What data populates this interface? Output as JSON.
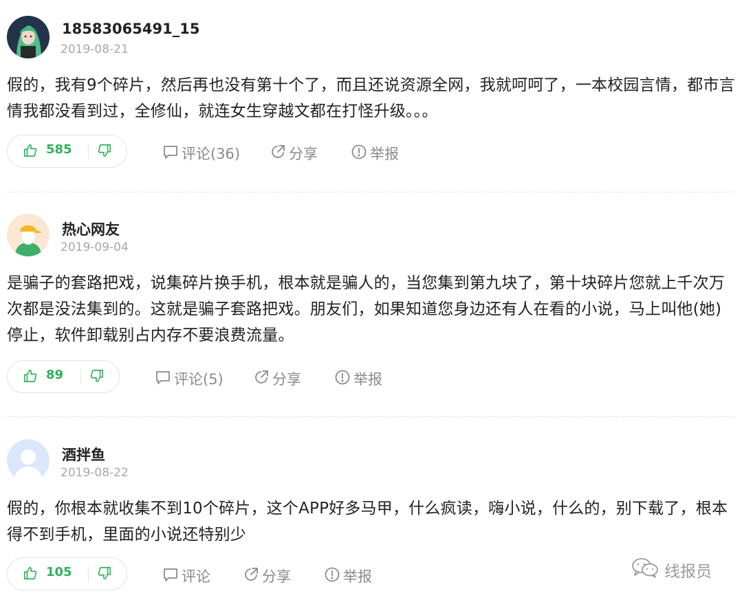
{
  "comments": [
    {
      "username": "18583065491_15",
      "date": "2019-08-21",
      "text": "假的，我有9个碎片，然后再也没有第十个了，而且还说资源全网，我就呵呵了，一本校园言情，都市言情我都没看到过，全修仙，就连女生穿越文都在打怪升级。。。",
      "likes": "585",
      "comment_label": "评论(36)",
      "share_label": "分享",
      "report_label": "举报",
      "avatar_icon": "anime-girl-avatar"
    },
    {
      "username": "热心网友",
      "date": "2019-09-04",
      "text": "是骗子的套路把戏，说集碎片换手机，根本就是骗人的，当您集到第九块了，第十块碎片您就上千次万次都是没法集到的。这就是骗子套路把戏。朋友们，如果知道您身边还有人在看的小说，马上叫他(她)停止，软件卸载别占内存不要浪费流量。",
      "likes": "89",
      "comment_label": "评论(5)",
      "share_label": "分享",
      "report_label": "举报",
      "avatar_icon": "cap-person-avatar"
    },
    {
      "username": "酒拌鱼",
      "date": "2019-08-22",
      "text": "假的，你根本就收集不到10个碎片，这个APP好多马甲，什么疯读，嗨小说，什么的，别下载了，根本得不到手机，里面的小说还特别少",
      "likes": "105",
      "comment_label": "评论",
      "share_label": "分享",
      "report_label": "举报",
      "avatar_icon": "default-person-avatar"
    }
  ],
  "watermark": {
    "text": "线报员",
    "icon": "wechat-icon"
  },
  "colors": {
    "like_green": "#2fb15a",
    "muted_gray": "#8a8a8a",
    "date_gray": "#a8a8a8"
  }
}
